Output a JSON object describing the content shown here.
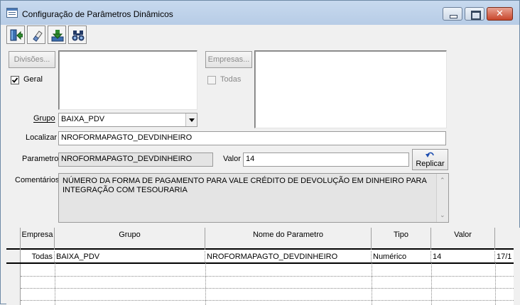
{
  "window": {
    "title": "Configuração de Parâmetros Dinâmicos",
    "close_glyph": "✕"
  },
  "toolbar": {
    "icons": [
      "exit-door-icon",
      "eraser-icon",
      "save-download-icon",
      "binoculars-search-icon"
    ]
  },
  "filters": {
    "divisoes_button": "Divisões...",
    "empresas_button": "Empresas...",
    "geral_label": "Geral",
    "geral_checked": true,
    "todas_label": "Todas",
    "todas_checked": false
  },
  "form": {
    "grupo_label": "Grupo",
    "grupo_value": "BAIXA_PDV",
    "localizar_label": "Localizar",
    "localizar_value": "NROFORMAPAGTO_DEVDINHEIRO",
    "parametro_label": "Parametro",
    "parametro_value": "NROFORMAPAGTO_DEVDINHEIRO",
    "valor_label": "Valor",
    "valor_value": "14",
    "replicar_label": "Replicar",
    "comentarios_label": "Comentários",
    "comentarios_value": "NÚMERO DA FORMA DE PAGAMENTO PARA VALE CRÉDITO DE DEVOLUÇÃO EM DINHEIRO PARA INTEGRAÇÃO COM TESOURARIA"
  },
  "grid": {
    "columns": [
      "Empresa",
      "Grupo",
      "Nome do Parametro",
      "Tipo",
      "Valor",
      ""
    ],
    "rows": [
      [
        "Todas",
        "BAIXA_PDV",
        "NROFORMAPAGTO_DEVDINHEIRO",
        "Numérico",
        "14",
        "17/1"
      ]
    ]
  },
  "colors": {
    "titlebar": "#b7cce6",
    "close_button": "#c8452a",
    "readonly_field": "#e4e4e4"
  }
}
